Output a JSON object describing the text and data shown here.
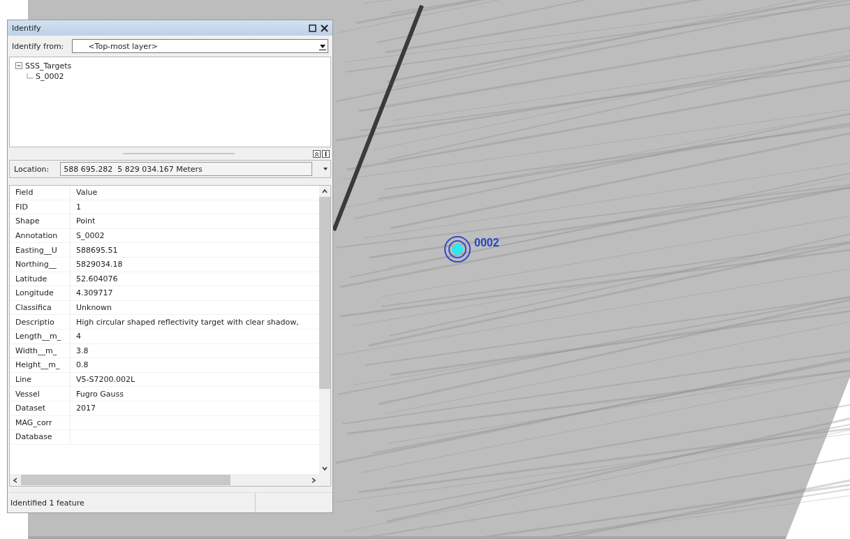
{
  "window": {
    "title": "Identify"
  },
  "identify_from": {
    "label": "Identify from:",
    "value": "<Top-most layer>"
  },
  "tree": [
    {
      "label": "SSS_Targets",
      "expanded": true,
      "children": [
        {
          "label": "S_0002"
        }
      ]
    }
  ],
  "location": {
    "label": "Location:",
    "value": "588 695.282  5 829 034.167 Meters"
  },
  "table": {
    "columns": [
      "Field",
      "Value"
    ],
    "rows": [
      {
        "field": "FID",
        "value": "1"
      },
      {
        "field": "Shape",
        "value": "Point"
      },
      {
        "field": "Annotation",
        "value": "S_0002"
      },
      {
        "field": "Easting__U",
        "value": "588695.51"
      },
      {
        "field": "Northing__",
        "value": "5829034.18"
      },
      {
        "field": "Latitude",
        "value": "52.604076"
      },
      {
        "field": "Longitude",
        "value": "4.309717"
      },
      {
        "field": "Classifica",
        "value": "Unknown"
      },
      {
        "field": "Descriptio",
        "value": "High circular shaped reflectivity target with clear shadow,"
      },
      {
        "field": "Length__m_",
        "value": "4"
      },
      {
        "field": "Width__m_",
        "value": "3.8"
      },
      {
        "field": "Height__m_",
        "value": "0.8"
      },
      {
        "field": "Line",
        "value": "V5-S7200.002L"
      },
      {
        "field": "Vessel",
        "value": "Fugro Gauss"
      },
      {
        "field": "Dataset",
        "value": "2017"
      },
      {
        "field": "MAG_corr"
      },
      {
        "field": "Database"
      }
    ]
  },
  "status_bar": "Identified 1 feature",
  "map": {
    "target_label": "0002"
  }
}
